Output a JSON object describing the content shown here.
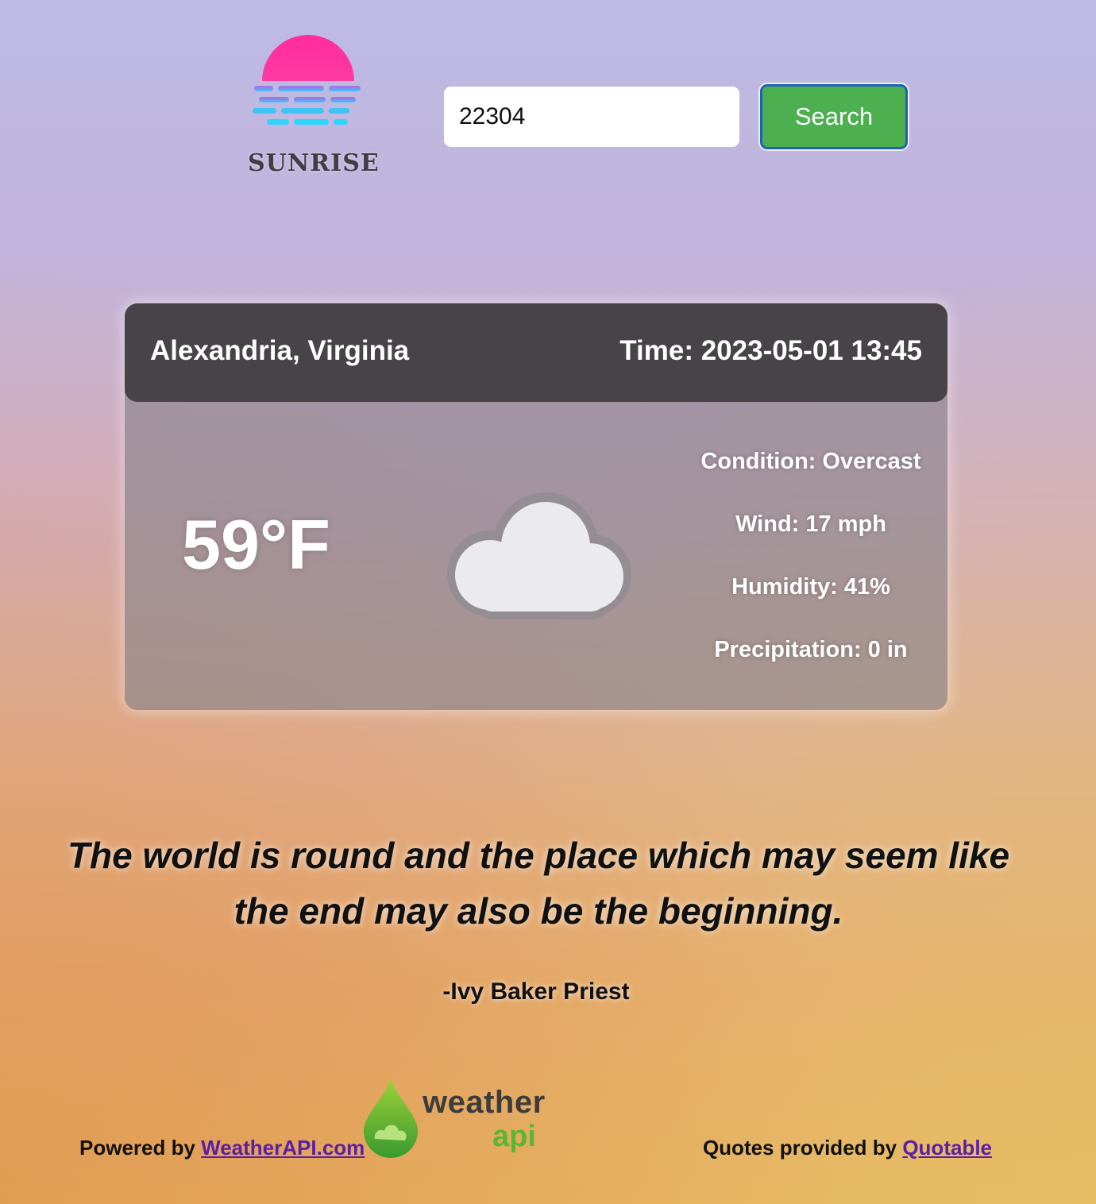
{
  "header": {
    "logo_text": "SUNRISE",
    "search_value": "22304",
    "search_button_label": "Search"
  },
  "weather": {
    "location": "Alexandria, Virginia",
    "time": "Time: 2023-05-01 13:45",
    "temperature": "59°F",
    "condition_icon": "cloud-icon",
    "details": {
      "condition": "Condition: Overcast",
      "wind": "Wind: 17 mph",
      "humidity": "Humidity: 41%",
      "precipitation": "Precipitation: 0 in"
    }
  },
  "quote": {
    "text": "The world is round and the place which may seem like the end may also be the beginning.",
    "author": "-Ivy Baker Priest"
  },
  "footer": {
    "powered_by_prefix": "Powered by ",
    "powered_by_link": "WeatherAPI.com",
    "weatherapi_logo_word1": "weather",
    "weatherapi_logo_word2": "api",
    "quotes_prefix": "Quotes provided by ",
    "quotes_link": "Quotable"
  },
  "colors": {
    "search_button": "#4caf50",
    "search_button_border": "#1e62b8",
    "card_header": "#474347",
    "link": "#5b1fa3"
  }
}
